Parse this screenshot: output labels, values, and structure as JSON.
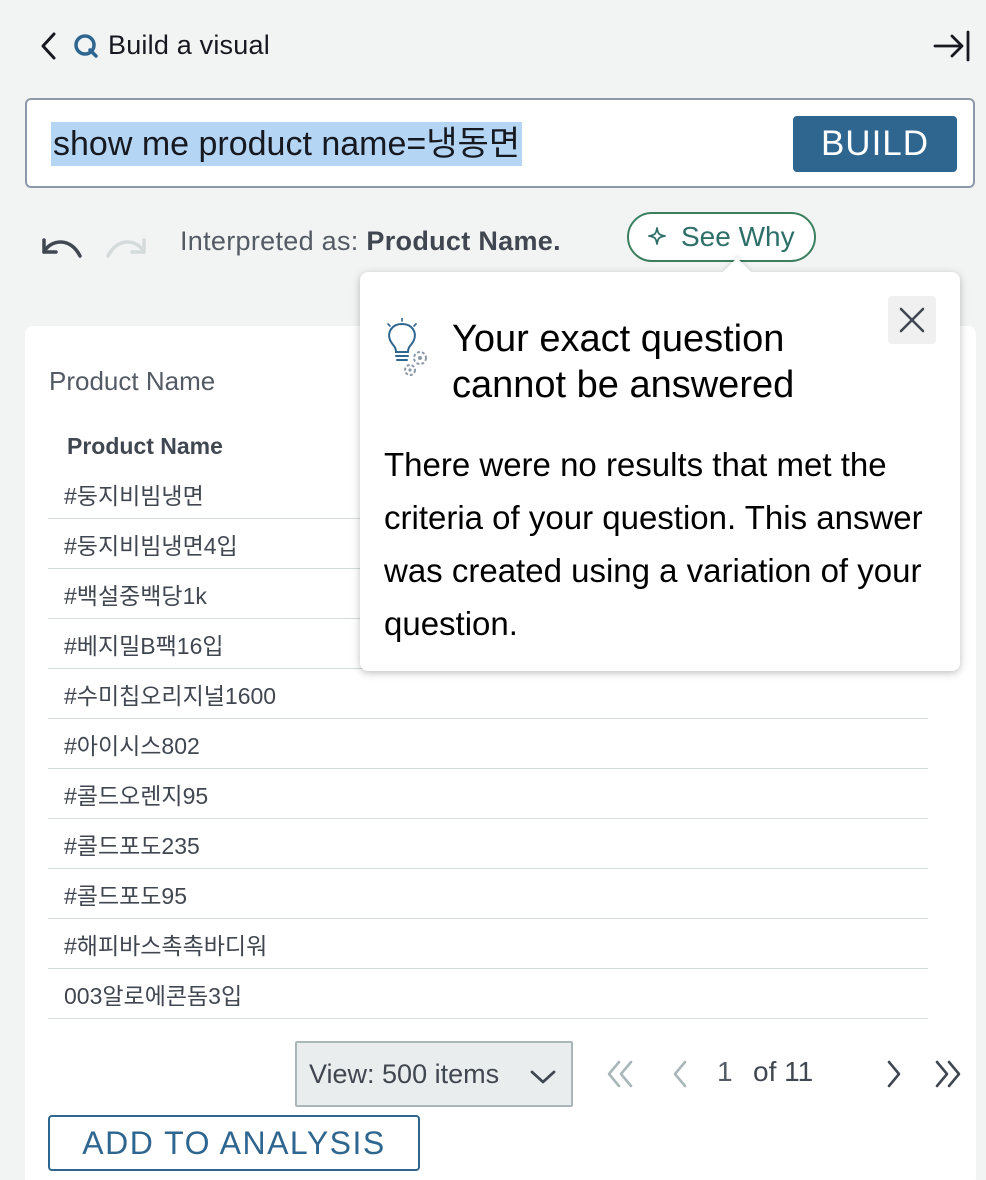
{
  "header": {
    "title": "Build a visual"
  },
  "query": {
    "text": "show me product name=냉동면",
    "build_label": "BUILD"
  },
  "interpretation": {
    "prefix": "Interpreted as:",
    "value": "Product Name.",
    "see_why_label": "See Why"
  },
  "panel": {
    "title": "Product Name",
    "table": {
      "column_header": "Product Name",
      "rows": [
        "#둥지비빔냉면",
        "#둥지비빔냉면4입",
        "#백설중백당1k",
        "#베지밀B팩16입",
        "#수미칩오리지널1600",
        "#아이시스802",
        "#콜드오렌지95",
        "#콜드포도235",
        "#콜드포도95",
        "#해피바스촉촉바디워",
        "003알로에콘돔3입"
      ]
    },
    "view_select": "View: 500 items",
    "pagination": {
      "current": "1",
      "of_label": "of 11"
    },
    "add_button": "ADD TO ANALYSIS"
  },
  "popover": {
    "title": "Your exact question cannot be answered",
    "body": "There were no results that met the criteria of your question. This answer was created using a variation of your question."
  },
  "colors": {
    "primary": "#2f6690",
    "see_why_border": "#3b7f5f",
    "selection_highlight": "#b5d5f5"
  }
}
